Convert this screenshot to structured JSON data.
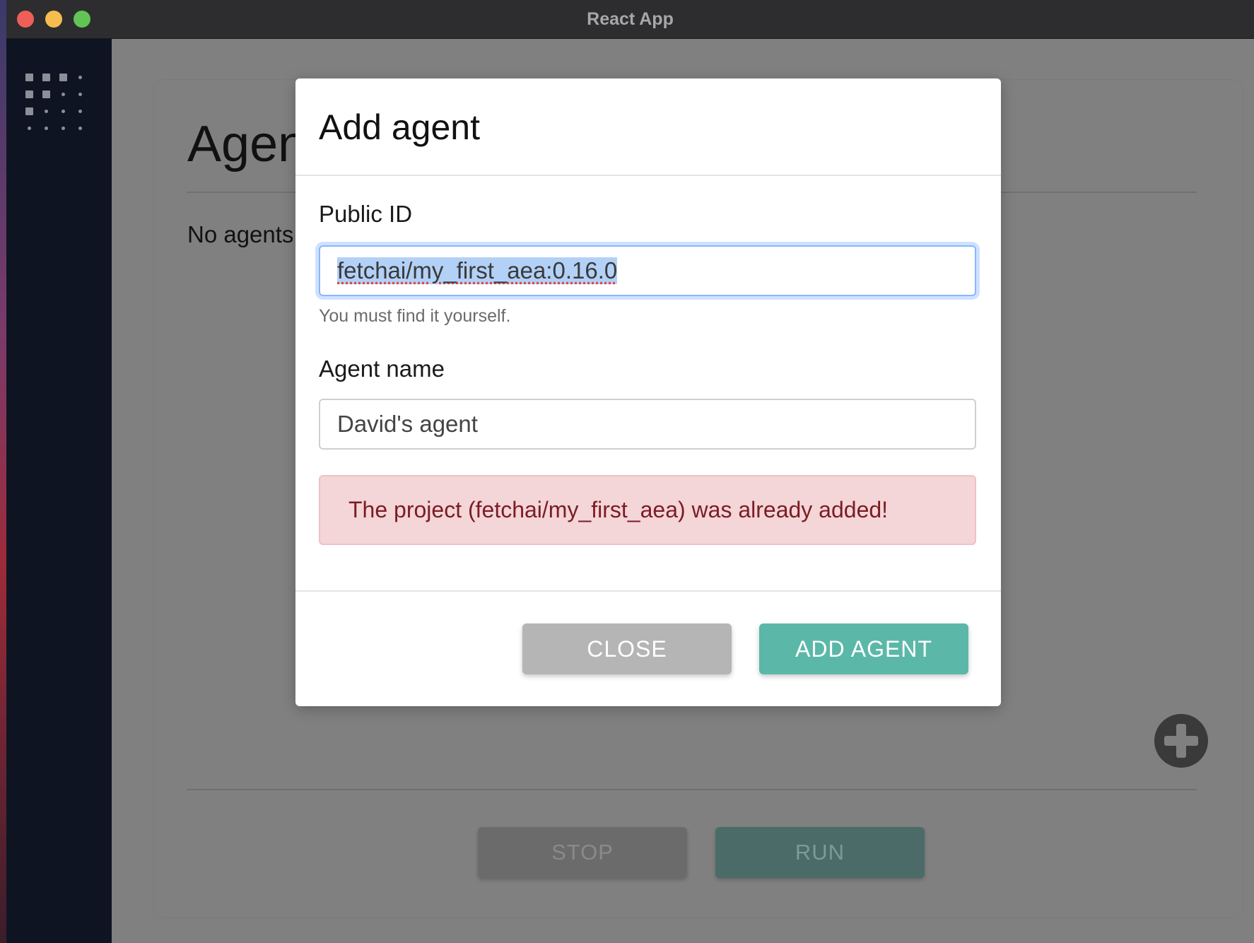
{
  "window": {
    "title": "React App"
  },
  "main": {
    "title": "Agents",
    "empty_text": "No agents",
    "stop_label": "STOP",
    "run_label": "RUN"
  },
  "modal": {
    "title": "Add agent",
    "public_id": {
      "label": "Public ID",
      "value": "fetchai/my_first_aea:0.16.0",
      "help": "You must find it yourself."
    },
    "agent_name": {
      "label": "Agent name",
      "value": "David's agent"
    },
    "error_message": "The project (fetchai/my_first_aea) was already added!",
    "close_label": "CLOSE",
    "add_label": "ADD AGENT"
  },
  "colors": {
    "accent_teal": "#5bb8a8",
    "error_bg": "#f4d5d8",
    "error_text": "#7a1d24",
    "focus_ring": "#86b7fe",
    "sidebar_bg": "#0f1422"
  },
  "icons": {
    "sidebar_logo": "dot-grid-logo-icon",
    "fab": "plus-circle-icon"
  }
}
